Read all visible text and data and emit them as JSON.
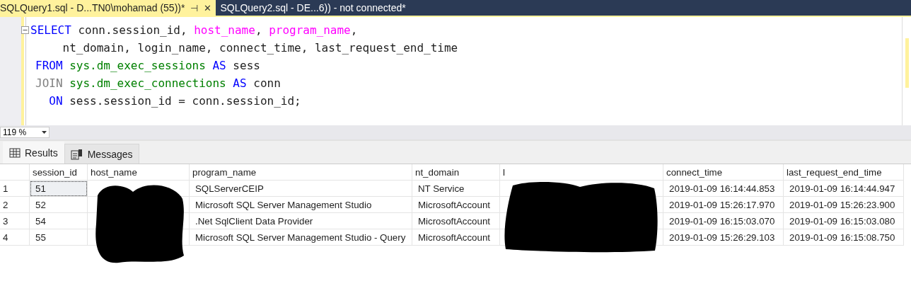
{
  "tabs": [
    {
      "label": "SQLQuery1.sql - D...TN0\\mohamad (55))*",
      "selected": true,
      "pin": "⊣",
      "close": "✕"
    },
    {
      "label": "SQLQuery2.sql - DE...6)) - not connected*",
      "selected": false
    }
  ],
  "editor": {
    "lines": [
      {
        "fold": true,
        "tokens": [
          {
            "kind": "keyword",
            "text": "SELECT"
          },
          {
            "kind": "plain",
            "text": " conn.session_id, "
          },
          {
            "kind": "function",
            "text": "host_name"
          },
          {
            "kind": "plain",
            "text": ", "
          },
          {
            "kind": "function",
            "text": "program_name"
          },
          {
            "kind": "plain",
            "text": ","
          }
        ]
      },
      {
        "fold": false,
        "tokens": [
          {
            "kind": "plain",
            "text": "    nt_domain, login_name, connect_time, last_request_end_time"
          }
        ]
      },
      {
        "fold": false,
        "tokens": [
          {
            "kind": "keyword",
            "text": "FROM"
          },
          {
            "kind": "system",
            "text": " sys.dm_exec_sessions"
          },
          {
            "kind": "keyword",
            "text": " AS"
          },
          {
            "kind": "plain",
            "text": " sess"
          }
        ]
      },
      {
        "fold": false,
        "tokens": [
          {
            "kind": "operator",
            "text": "JOIN"
          },
          {
            "kind": "system",
            "text": " sys.dm_exec_connections"
          },
          {
            "kind": "keyword",
            "text": " AS"
          },
          {
            "kind": "plain",
            "text": " conn"
          }
        ]
      },
      {
        "fold": false,
        "tokens": [
          {
            "kind": "keyword",
            "text": "  ON"
          },
          {
            "kind": "plain",
            "text": " sess.session_id = conn.session_id;"
          }
        ]
      }
    ],
    "zoom": "119 %"
  },
  "result_tabs": [
    {
      "label": "Results",
      "selected": true
    },
    {
      "label": "Messages",
      "selected": false
    }
  ],
  "table": {
    "columns": [
      "session_id",
      "host_name",
      "program_name",
      "nt_domain",
      "l",
      "connect_time",
      "last_request_end_time"
    ],
    "rows": [
      {
        "number": "1",
        "selected": true,
        "cells": [
          "51",
          null,
          "SQLServerCEIP",
          "NT Service",
          null,
          "2019-01-09 16:14:44.853",
          "2019-01-09 16:14:44.947"
        ]
      },
      {
        "number": "2",
        "selected": false,
        "cells": [
          "52",
          null,
          "Microsoft SQL Server Management Studio",
          "MicrosoftAccount",
          null,
          "2019-01-09 15:26:17.970",
          "2019-01-09 15:26:23.900"
        ]
      },
      {
        "number": "3",
        "selected": false,
        "cells": [
          "54",
          null,
          ".Net SqlClient Data Provider",
          "MicrosoftAccount",
          null,
          "2019-01-09 16:15:03.070",
          "2019-01-09 16:15:03.080"
        ]
      },
      {
        "number": "4",
        "selected": false,
        "cells": [
          "55",
          null,
          "Microsoft SQL Server Management Studio - Query",
          "MicrosoftAccount",
          null,
          "2019-01-09 15:26:29.103",
          "2019-01-09 16:15:08.750"
        ]
      }
    ]
  }
}
